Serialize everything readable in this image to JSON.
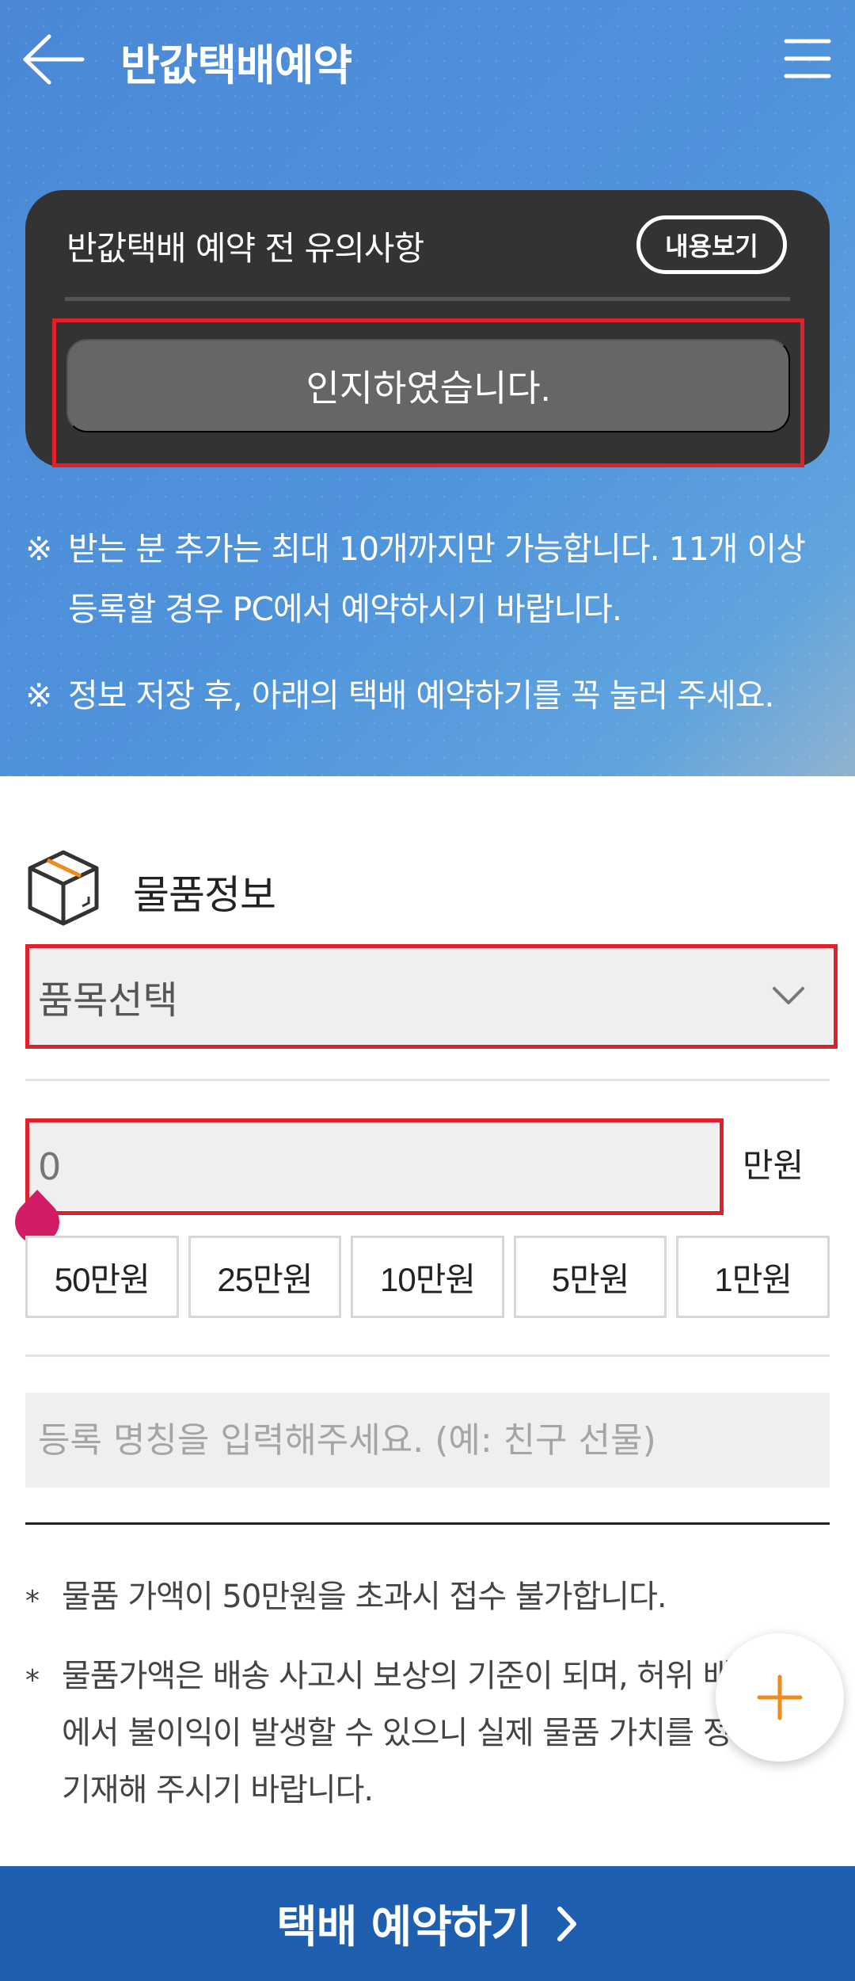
{
  "header": {
    "title": "반값택배예약"
  },
  "notice": {
    "title": "반값택배 예약 전 유의사항",
    "view_label": "내용보기",
    "ack_label": "인지하였습니다."
  },
  "notes": {
    "mark": "※",
    "line1": "받는 분 추가는 최대 10개까지만 가능합니다. 11개 이상 등록할 경우 PC에서 예약하시기 바랍니다.",
    "line2": "정보 저장 후, 아래의 택배 예약하기를 꼭 눌러 주세요."
  },
  "item_section": {
    "title": "물품정보",
    "select_value": "품목선택",
    "amount_placeholder": "0",
    "amount_unit": "만원",
    "chips": [
      "50만원",
      "25만원",
      "10만원",
      "5만원",
      "1만원"
    ],
    "name_placeholder": "등록 명칭을 입력해주세요. (예: 친구 선물)"
  },
  "footnotes": {
    "mark": "*",
    "note1": "물품 가액이 50만원을 초과시 접수 불가합니다.",
    "note2": "물품가액은 배송 사고시 보상의 기준이 되며, 허위 배송과정에서 불이익이 발생할 수 있으니 실제 물품 가치를 정확히 기재해 주시기 바랍니다."
  },
  "bottom": {
    "label": "택배 예약하기"
  },
  "colors": {
    "hero_blue": "#4a88d6",
    "card_dark": "#333333",
    "ack_gray": "#666666",
    "highlight_red": "#e0202a",
    "bottom_blue": "#1f5fb0",
    "fab_orange": "#f08a1c",
    "cursor_pink": "#d21c66"
  },
  "icons": {
    "back": "arrow-left-icon",
    "menu": "hamburger-menu-icon",
    "box": "package-box-icon",
    "chevron": "chevron-down-icon",
    "plus": "plus-icon",
    "next": "chevron-right-icon"
  }
}
